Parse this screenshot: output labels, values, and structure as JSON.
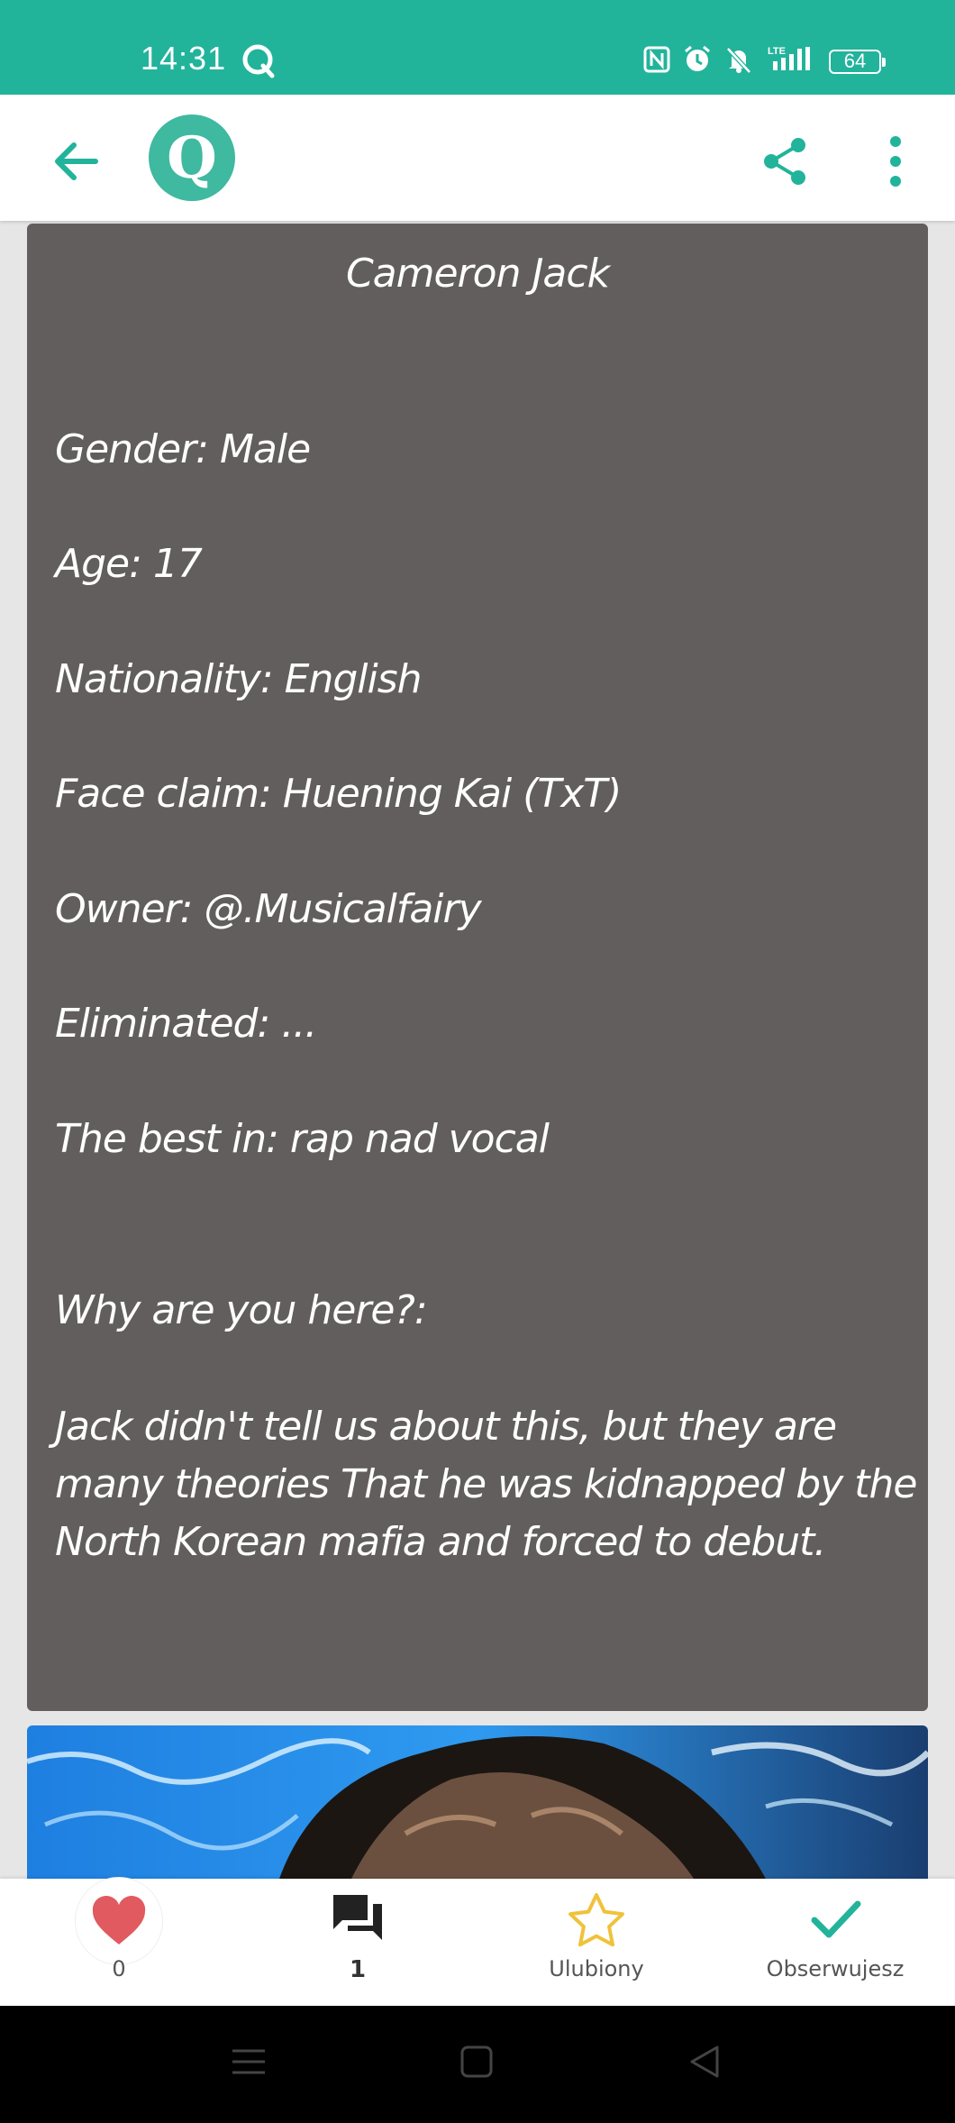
{
  "status": {
    "time": "14:31",
    "battery": "64",
    "icons": [
      "q-app-icon",
      "nfc-icon",
      "alarm-icon",
      "mute-icon",
      "lte-signal-icon",
      "battery-icon"
    ]
  },
  "colors": {
    "accent": "#22b39b",
    "card_bg": "#625e5d",
    "heart": "#e05a5f",
    "star": "#f0c23a"
  },
  "app_bar": {
    "logo_letter": "Q",
    "icons": [
      "back-arrow-icon",
      "share-icon",
      "more-vert-icon"
    ]
  },
  "card": {
    "title": "Cameron Jack",
    "fields": [
      "Gender: Male",
      "Age: 17",
      "Nationality: English",
      "Face claim: Huening Kai (TxT)",
      "Owner: @.Musicalfairy",
      "Eliminated: ...",
      "The best in: rap nad vocal",
      "Why are you here?:"
    ],
    "story": "Jack didn't tell us about this, but they are many theories That he was kidnapped by the North Korean mafia and forced to debut."
  },
  "actions": {
    "likes": "0",
    "comments": "1",
    "favorite": "Ulubiony",
    "follow": "Obserwujesz"
  }
}
